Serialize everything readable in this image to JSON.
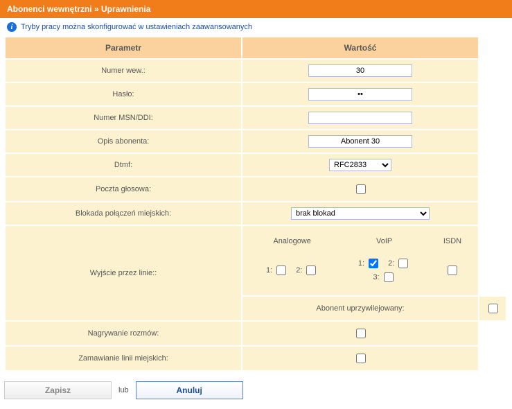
{
  "header": {
    "breadcrumb": "Abonenci wewnętrzni » Uprawnienia"
  },
  "info": {
    "text": "Tryby pracy można skonfigurować w ustawieniach zaawansowanych"
  },
  "table": {
    "col_param": "Parametr",
    "col_value": "Wartość",
    "rows": {
      "ext": {
        "label": "Numer wew.:",
        "value": "30"
      },
      "pass": {
        "label": "Hasło:",
        "value": "••"
      },
      "msn": {
        "label": "Numer MSN/DDI:",
        "value": ""
      },
      "desc": {
        "label": "Opis abonenta:",
        "value": "Abonent 30"
      },
      "dtmf": {
        "label": "Dtmf:",
        "value": "RFC2833"
      },
      "vmail": {
        "label": "Poczta głosowa:"
      },
      "block": {
        "label": "Blokada połączeń miejskich:",
        "value": "brak blokad"
      },
      "lines": {
        "label": "Wyjście przez linie::",
        "types": {
          "analog": "Analogowe",
          "voip": "VoIP",
          "isdn": "ISDN"
        },
        "labels": {
          "l1": "1:",
          "l2": "2:",
          "l3": "3:"
        }
      },
      "priv": {
        "label": "Abonent uprzywilejowany:"
      },
      "rec": {
        "label": "Nagrywanie rozmów:"
      },
      "order": {
        "label": "Zamawianie linii miejskich:"
      }
    }
  },
  "footer": {
    "save": "Zapisz",
    "or": "lub",
    "cancel": "Anuluj"
  }
}
